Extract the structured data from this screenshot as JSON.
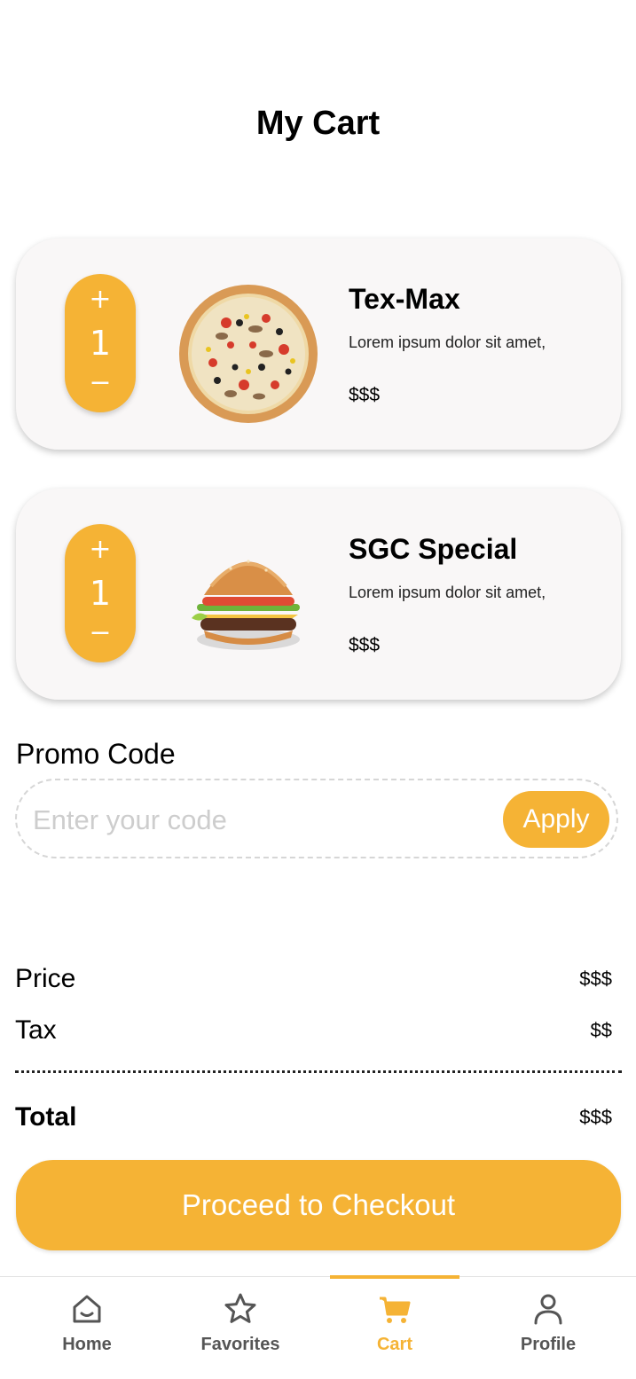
{
  "page": {
    "title": "My Cart"
  },
  "cart": {
    "items": [
      {
        "name": "Tex-Max",
        "description": "Lorem ipsum dolor sit amet,",
        "price": "$$$",
        "quantity": "1",
        "image_icon": "pizza-image",
        "plus": "+",
        "minus": "−"
      },
      {
        "name": "SGC Special",
        "description": "Lorem ipsum dolor sit amet,",
        "price": "$$$",
        "quantity": "1",
        "image_icon": "burger-image",
        "plus": "+",
        "minus": "−"
      }
    ]
  },
  "promo": {
    "label": "Promo Code",
    "placeholder": "Enter your code",
    "value": "",
    "apply_label": "Apply"
  },
  "summary": {
    "price_label": "Price",
    "price_value": "$$$",
    "tax_label": "Tax",
    "tax_value": "$$",
    "total_label": "Total",
    "total_value": "$$$"
  },
  "checkout": {
    "label": "Proceed to Checkout"
  },
  "nav": {
    "active": "Cart",
    "items": [
      {
        "label": "Home",
        "icon": "home-icon"
      },
      {
        "label": "Favorites",
        "icon": "star-icon"
      },
      {
        "label": "Cart",
        "icon": "cart-icon"
      },
      {
        "label": "Profile",
        "icon": "profile-icon"
      }
    ]
  },
  "colors": {
    "accent": "#f5b335",
    "card_bg": "#f9f7f7",
    "nav_inactive": "#555555"
  }
}
